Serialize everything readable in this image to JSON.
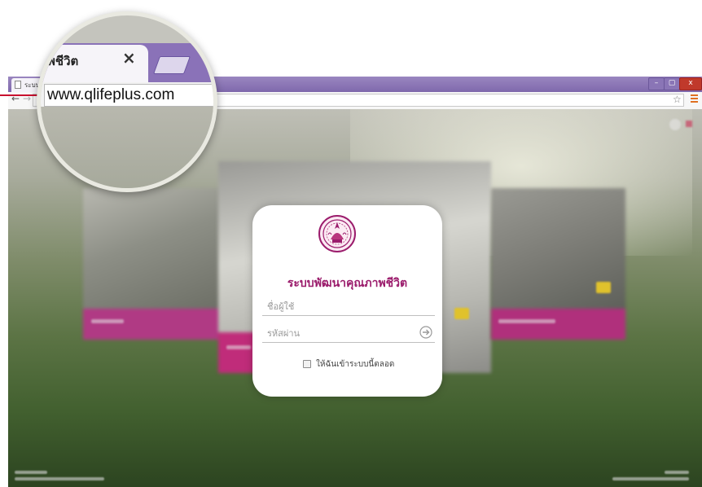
{
  "browser": {
    "small_tab_label": "ระบบ",
    "window_controls": {
      "minimize": "–",
      "maximize": "▢",
      "close": "x"
    },
    "nav": {
      "back": "←",
      "forward": "→"
    },
    "star_icon": "star-icon",
    "menu_icon": "menu-icon"
  },
  "magnifier": {
    "tab_label": "พชีวิต",
    "tab_close": "×",
    "url": "www.qlifeplus.com"
  },
  "login": {
    "title": "ระบบพัฒนาคุณภาพชีวิต",
    "username_placeholder": "ชื่อผู้ใช้",
    "password_placeholder": "รหัสผ่าน",
    "remember_label": "ให้ฉันเข้าระบบนี้ตลอด",
    "remember_checked": false,
    "submit_icon": "arrow-right-circle-icon",
    "seal_icon": "government-seal-icon"
  },
  "colors": {
    "accent": "#9b1c6c",
    "card_band": "#c02c7a",
    "tabbar": "#8a72b8"
  }
}
